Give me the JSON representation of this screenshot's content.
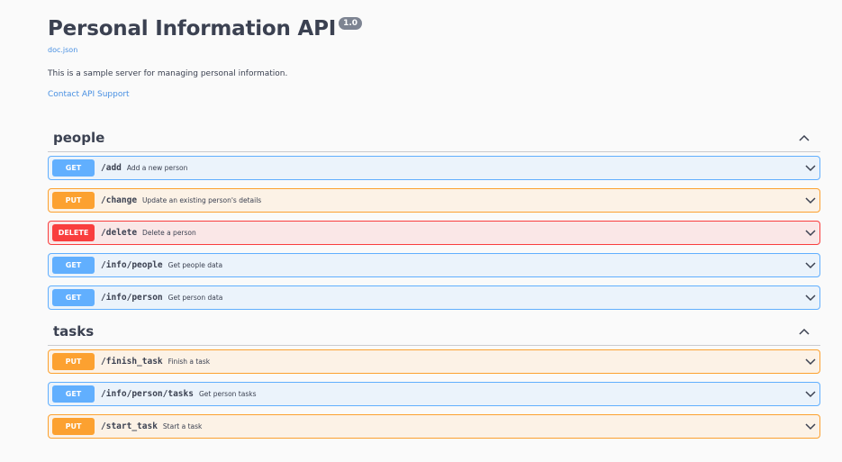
{
  "info": {
    "title": "Personal Information API",
    "version": "1.0",
    "doc_link": "doc.json",
    "description": "This is a sample server for managing personal information.",
    "contact": "Contact API Support"
  },
  "sections": [
    {
      "name": "people",
      "operations": [
        {
          "method": "GET",
          "path": "/add",
          "summary": "Add a new person"
        },
        {
          "method": "PUT",
          "path": "/change",
          "summary": "Update an existing person's details"
        },
        {
          "method": "DELETE",
          "path": "/delete",
          "summary": "Delete a person"
        },
        {
          "method": "GET",
          "path": "/info/people",
          "summary": "Get people data"
        },
        {
          "method": "GET",
          "path": "/info/person",
          "summary": "Get person data"
        }
      ]
    },
    {
      "name": "tasks",
      "operations": [
        {
          "method": "PUT",
          "path": "/finish_task",
          "summary": "Finish a task"
        },
        {
          "method": "GET",
          "path": "/info/person/tasks",
          "summary": "Get person tasks"
        },
        {
          "method": "PUT",
          "path": "/start_task",
          "summary": "Start a task"
        }
      ]
    }
  ]
}
